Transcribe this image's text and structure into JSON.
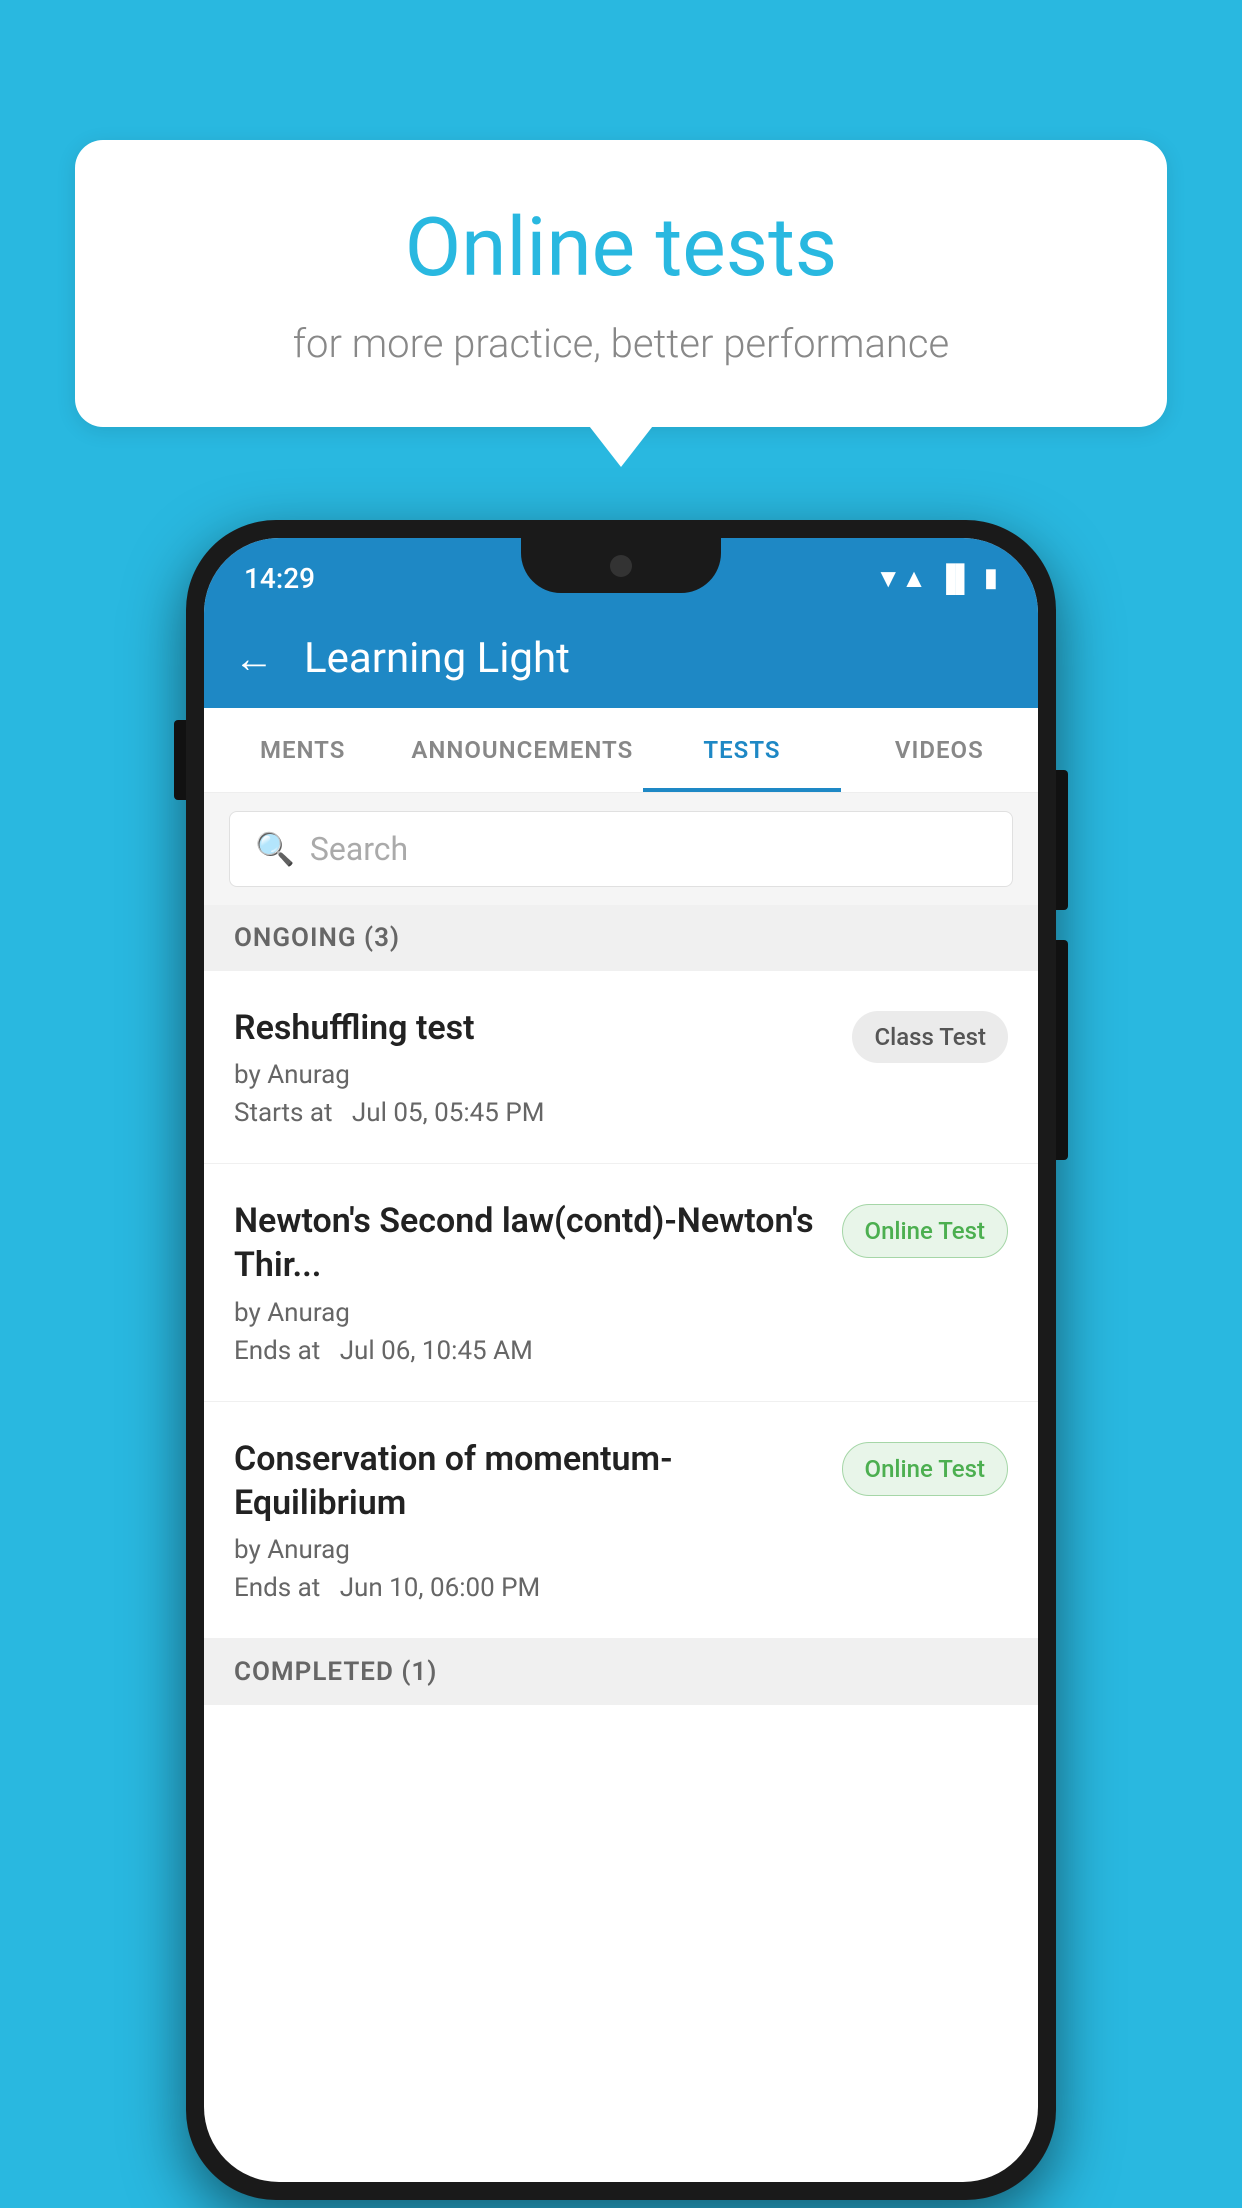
{
  "background_color": "#29B8E0",
  "bubble": {
    "title": "Online tests",
    "subtitle": "for more practice, better performance"
  },
  "phone": {
    "status_bar": {
      "time": "14:29",
      "icons": [
        "wifi",
        "signal",
        "battery"
      ]
    },
    "header": {
      "title": "Learning Light",
      "back_label": "←"
    },
    "tabs": [
      {
        "label": "MENTS",
        "active": false
      },
      {
        "label": "ANNOUNCEMENTS",
        "active": false
      },
      {
        "label": "TESTS",
        "active": true
      },
      {
        "label": "VIDEOS",
        "active": false
      }
    ],
    "search": {
      "placeholder": "Search"
    },
    "sections": [
      {
        "title": "ONGOING (3)",
        "items": [
          {
            "name": "Reshuffling test",
            "author": "by Anurag",
            "date_label": "Starts at",
            "date_value": "Jul 05, 05:45 PM",
            "badge": "Class Test",
            "badge_type": "class"
          },
          {
            "name": "Newton's Second law(contd)-Newton's Thir...",
            "author": "by Anurag",
            "date_label": "Ends at",
            "date_value": "Jul 06, 10:45 AM",
            "badge": "Online Test",
            "badge_type": "online"
          },
          {
            "name": "Conservation of momentum-Equilibrium",
            "author": "by Anurag",
            "date_label": "Ends at",
            "date_value": "Jun 10, 06:00 PM",
            "badge": "Online Test",
            "badge_type": "online"
          }
        ]
      },
      {
        "title": "COMPLETED (1)",
        "items": []
      }
    ]
  }
}
